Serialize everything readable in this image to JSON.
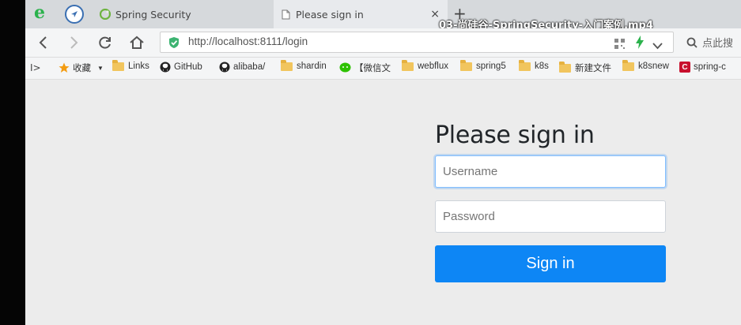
{
  "browser": {
    "tabs": [
      {
        "label": "Spring Security",
        "active": false
      },
      {
        "label": "Please sign in",
        "active": true
      }
    ],
    "new_tab_symbol": "+",
    "close_symbol": "×",
    "video_title": "03-尚硅谷-SpringSecurity-入门案例.mp4",
    "address": {
      "url": "http://localhost:8111/login",
      "search_placeholder": "点此搜"
    },
    "bookmarks": {
      "toggle": "I>",
      "favorites_label": "收藏",
      "items": [
        {
          "label": "Links",
          "icon": "folder-icon"
        },
        {
          "label": "GitHub",
          "icon": "github-icon"
        },
        {
          "label": "alibaba/",
          "icon": "github-icon"
        },
        {
          "label": "shardin",
          "icon": "folder-icon"
        },
        {
          "label": "【微信文",
          "icon": "wechat-icon"
        },
        {
          "label": "webflux",
          "icon": "folder-icon"
        },
        {
          "label": "spring5",
          "icon": "folder-icon"
        },
        {
          "label": "k8s",
          "icon": "folder-icon"
        },
        {
          "label": "新建文件",
          "icon": "folder-icon"
        },
        {
          "label": "k8snew",
          "icon": "folder-icon"
        },
        {
          "label": "spring-c",
          "icon": "c-badge-icon"
        }
      ]
    }
  },
  "page": {
    "heading": "Please sign in",
    "username_placeholder": "Username",
    "password_placeholder": "Password",
    "submit_label": "Sign in"
  },
  "colors": {
    "accent": "#0d86f5",
    "focus_border": "#80bdff",
    "page_bg": "#ececec"
  }
}
